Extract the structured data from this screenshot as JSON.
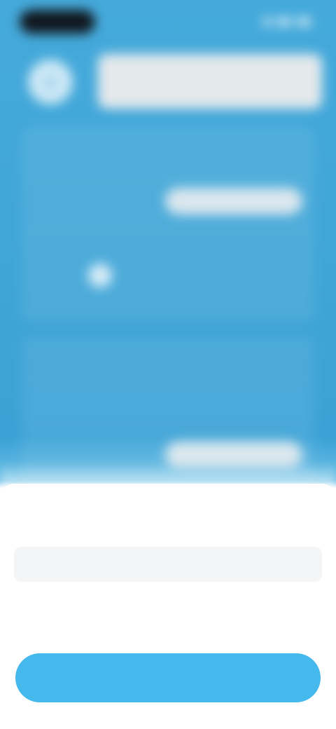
{
  "status_bar": {
    "time": "",
    "icons": [
      "signal-icon",
      "wifi-icon",
      "battery-icon"
    ]
  },
  "header": {
    "avatar_icon": "user-icon",
    "search_placeholder": ""
  },
  "cards": [
    {
      "rows": [
        {
          "label": "",
          "value": ""
        },
        {
          "label": "",
          "action": ""
        },
        {
          "label": "",
          "value": ""
        }
      ]
    },
    {
      "rows": [
        {
          "label": "",
          "value": ""
        },
        {
          "label": "",
          "action": ""
        }
      ]
    }
  ],
  "sheet": {
    "picker": {
      "options": [
        "",
        "",
        ""
      ],
      "selected": ""
    },
    "confirm_label": ""
  },
  "colors": {
    "background": "#3ea4d6",
    "accent": "#45b8ec",
    "sheet": "#ffffff"
  }
}
